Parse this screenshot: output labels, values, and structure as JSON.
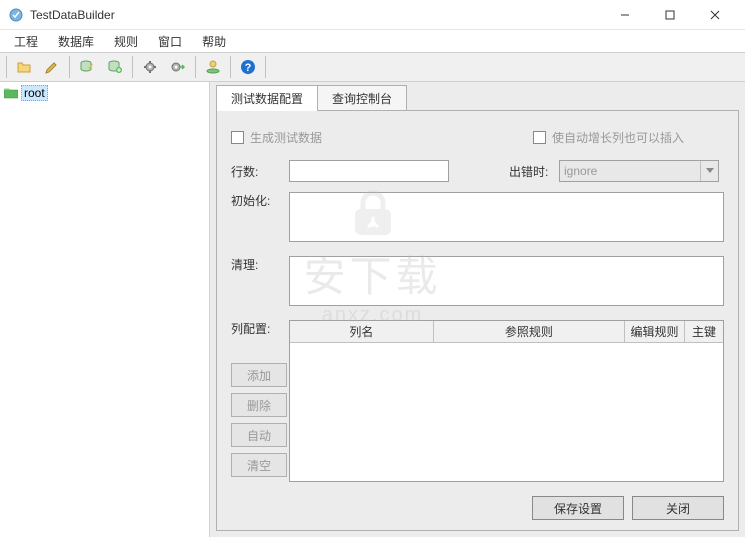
{
  "window": {
    "title": "TestDataBuilder"
  },
  "menubar": {
    "items": [
      "工程",
      "数据库",
      "规则",
      "窗口",
      "帮助"
    ]
  },
  "tree": {
    "root_label": "root"
  },
  "tabs": {
    "items": [
      "测试数据配置",
      "查询控制台"
    ],
    "active_index": 0
  },
  "config": {
    "checkbox1_label": "生成测试数据",
    "checkbox2_label": "使自动增长列也可以插入",
    "rows_label": "行数:",
    "rows_value": "",
    "onerror_label": "出错时:",
    "onerror_value": "ignore",
    "init_label": "初始化:",
    "init_value": "",
    "cleanup_label": "清理:",
    "cleanup_value": "",
    "colconfig_label": "列配置:",
    "buttons": {
      "add": "添加",
      "delete": "删除",
      "auto": "自动",
      "clear": "清空"
    },
    "table_headers": {
      "col_name": "列名",
      "ref_rule": "参照规则",
      "edit_rule": "编辑规则",
      "pk": "主键"
    },
    "save": "保存设置",
    "close": "关闭"
  },
  "watermark": {
    "text": "安下载",
    "sub": "anxz.com"
  }
}
